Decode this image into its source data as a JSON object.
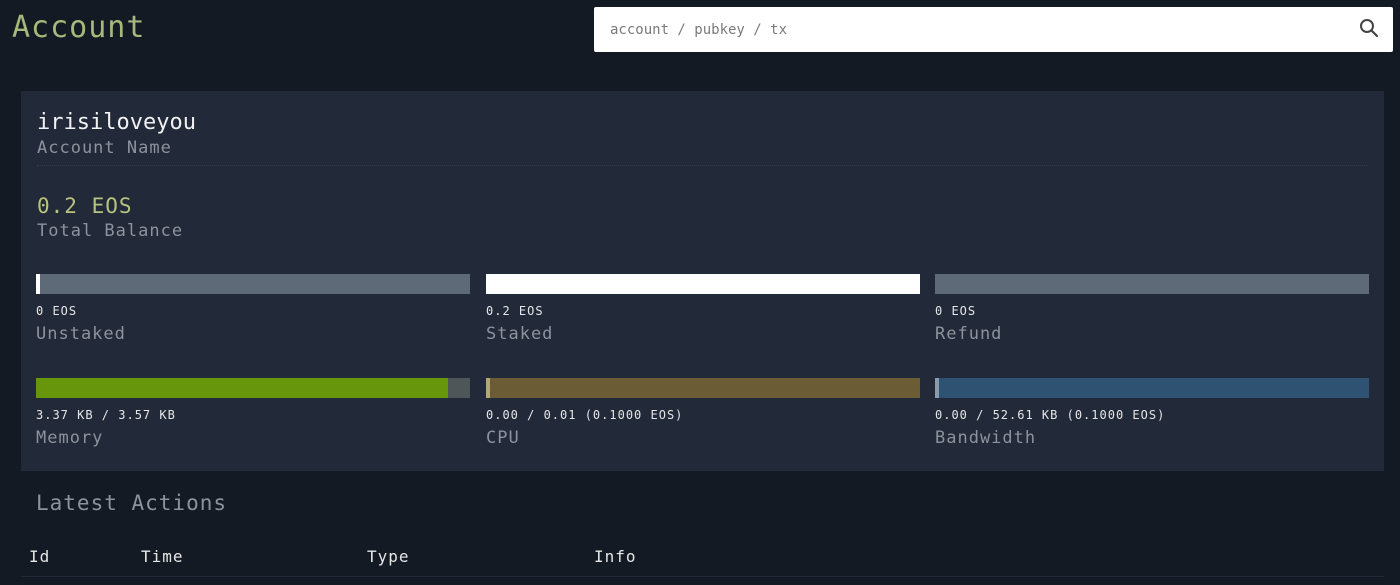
{
  "header": {
    "title": "Account"
  },
  "search": {
    "placeholder": "account / pubkey / tx",
    "value": "",
    "icon": "search-icon"
  },
  "account": {
    "name": "irisiloveyou",
    "name_label": "Account Name",
    "balance": "0.2 EOS",
    "balance_label": "Total Balance"
  },
  "stats": {
    "unstaked": {
      "value": "0 EOS",
      "label": "Unstaked",
      "fill_percent": 1,
      "color": "#ffffff",
      "track": "#5f6a78"
    },
    "staked": {
      "value": "0.2 EOS",
      "label": "Staked",
      "fill_percent": 100,
      "color": "#ffffff",
      "track": "#5f6a78"
    },
    "refund": {
      "value": "0 EOS",
      "label": "Refund",
      "fill_percent": 0,
      "color": "#ffffff",
      "track": "#5f6a78"
    },
    "memory": {
      "value": "3.37 KB / 3.57 KB",
      "label": "Memory",
      "fill_percent": 95,
      "color": "#67960d",
      "track": "#4f5658"
    },
    "cpu": {
      "value": "0.00 / 0.01 (0.1000 EOS)",
      "label": "CPU",
      "fill_percent": 1,
      "color": "#b3a67a",
      "track": "#6b5c36"
    },
    "bandwidth": {
      "value": "0.00 / 52.61 KB (0.1000 EOS)",
      "label": "Bandwidth",
      "fill_percent": 1,
      "color": "#8a9aaa",
      "track": "#2f5172"
    }
  },
  "actions": {
    "title": "Latest Actions",
    "columns": [
      "Id",
      "Time",
      "Type",
      "Info"
    ]
  }
}
